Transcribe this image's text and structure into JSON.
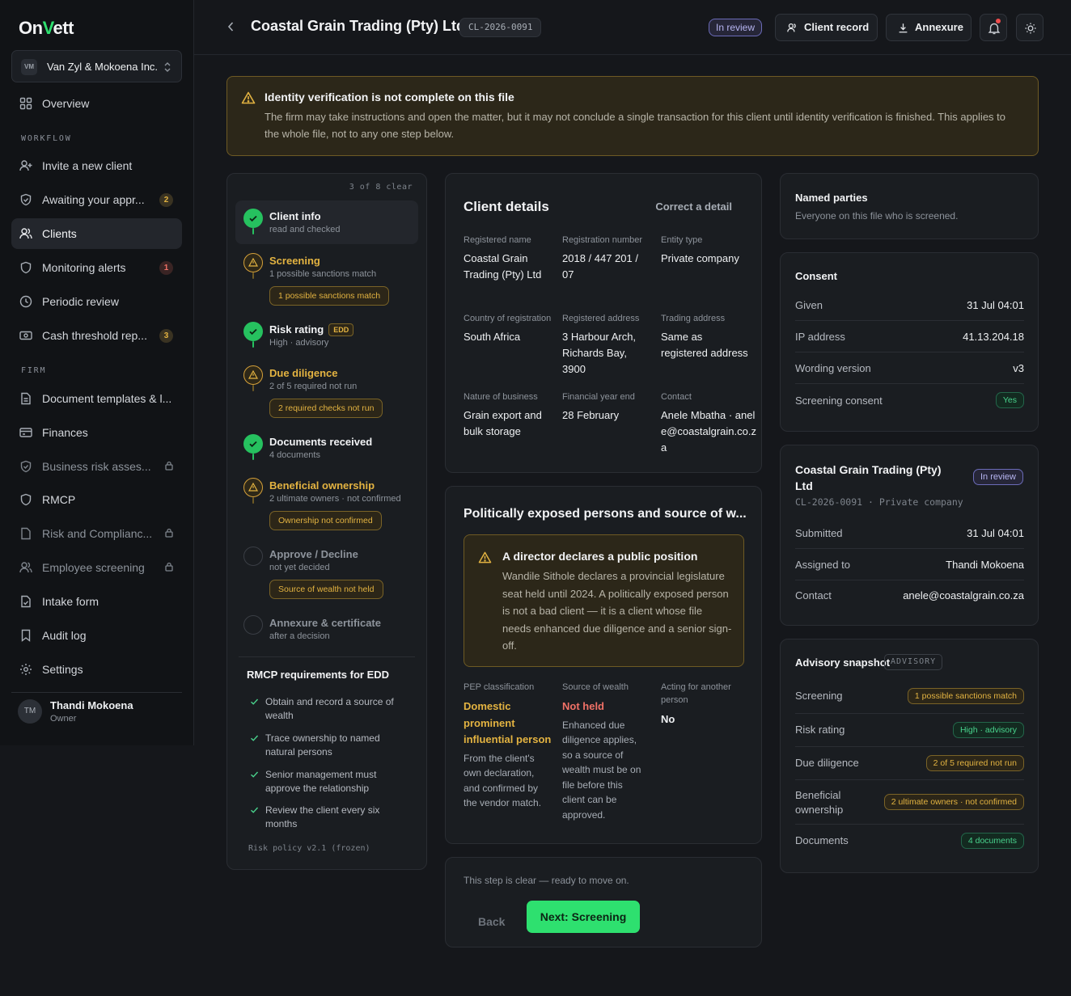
{
  "app": {
    "logo_prefix": "On",
    "logo_v": "V",
    "logo_suffix": "ett"
  },
  "org": {
    "initials": "VM",
    "name": "Van Zyl & Mokoena Inc."
  },
  "nav": {
    "overview": "Overview",
    "workflow_label": "WORKFLOW",
    "invite": "Invite a new client",
    "awaiting": "Awaiting your appr...",
    "awaiting_count": "2",
    "clients": "Clients",
    "monitoring": "Monitoring alerts",
    "monitoring_count": "1",
    "periodic": "Periodic review",
    "cash": "Cash threshold rep...",
    "cash_count": "3",
    "firm_label": "FIRM",
    "templates": "Document templates & l...",
    "finances": "Finances",
    "business_risk": "Business risk asses...",
    "rmcp": "RMCP",
    "risk_compliance": "Risk and Complianc...",
    "employee": "Employee screening",
    "intake": "Intake form",
    "audit": "Audit log",
    "settings": "Settings"
  },
  "user": {
    "initials": "TM",
    "name": "Thandi Mokoena",
    "role": "Owner"
  },
  "header": {
    "title": "Coastal Grain Trading (Pty) Ltd",
    "client_id": "CL-2026-0091",
    "status": "In review",
    "client_record_btn": "Client record",
    "annexure_btn": "Annexure"
  },
  "alert": {
    "title": "Identity verification is not complete on this file",
    "body": "The firm may take instructions and open the matter, but it may not conclude a single transaction for this client until identity verification is finished. This applies to the whole file, not to any one step below."
  },
  "steps": {
    "count": "3 of 8 clear",
    "items": [
      {
        "name": "Client info",
        "sub": "read and checked"
      },
      {
        "name": "Screening",
        "sub": "1 possible sanctions match",
        "tag": "1 possible sanctions match"
      },
      {
        "name": "Risk rating",
        "badge": "EDD",
        "sub": "High · advisory"
      },
      {
        "name": "Due diligence",
        "sub": "2 of 5 required not run",
        "tag": "2 required checks not run"
      },
      {
        "name": "Documents received",
        "sub": "4 documents"
      },
      {
        "name": "Beneficial ownership",
        "sub": "2 ultimate owners · not confirmed",
        "tag": "Ownership not confirmed"
      },
      {
        "name": "Approve / Decline",
        "sub": "not yet decided",
        "tag": "Source of wealth not held"
      },
      {
        "name": "Annexure & certificate",
        "sub": "after a decision"
      }
    ],
    "req_title": "RMCP requirements for EDD",
    "reqs": [
      "Obtain and record a source of wealth",
      "Trace ownership to named natural persons",
      "Senior management must approve the relationship",
      "Review the client every six months"
    ],
    "policy": "Risk policy v2.1 (frozen)"
  },
  "client_details": {
    "title": "Client details",
    "correct_link": "Correct a detail",
    "fields": [
      {
        "label": "Registered name",
        "value": "Coastal Grain Trading (Pty) Ltd"
      },
      {
        "label": "Registration number",
        "value": "2018 / 447 201 / 07"
      },
      {
        "label": "Entity type",
        "value": "Private company"
      },
      {
        "label": "Country of registration",
        "value": "South Africa"
      },
      {
        "label": "Registered address",
        "value": "3 Harbour Arch, Richards Bay, 3900"
      },
      {
        "label": "Trading address",
        "value": "Same as registered address"
      },
      {
        "label": "Nature of business",
        "value": "Grain export and bulk storage"
      },
      {
        "label": "Financial year end",
        "value": "28 February"
      },
      {
        "label": "Contact",
        "value": "Anele Mbatha · anele@coastalgrain.co.za"
      }
    ]
  },
  "pep": {
    "title": "Politically exposed persons and source of w...",
    "warn_title": "A director declares a public position",
    "warn_body": "Wandile Sithole declares a provincial legislature seat held until 2024. A politically exposed person is not a bad client — it is a client whose file needs enhanced due diligence and a senior sign-off.",
    "classification_label": "PEP classification",
    "classification_value": "Domestic prominent influential person",
    "classification_note": "From the client's own declaration, and confirmed by the vendor match.",
    "wealth_label": "Source of wealth",
    "wealth_value": "Not held",
    "wealth_note": "Enhanced due diligence applies, so a source of wealth must be on file before this client can be approved.",
    "acting_label": "Acting for another person",
    "acting_value": "No"
  },
  "footer_step": {
    "note": "This step is clear — ready to move on.",
    "back": "Back",
    "next": "Next: Screening"
  },
  "named_parties": {
    "title": "Named parties",
    "sub": "Everyone on this file who is screened."
  },
  "consent": {
    "title": "Consent",
    "rows": [
      {
        "k": "Given",
        "v": "31 Jul 04:01"
      },
      {
        "k": "IP address",
        "v": "41.13.204.18"
      },
      {
        "k": "Wording version",
        "v": "v3"
      },
      {
        "k": "Screening consent",
        "v": "Yes"
      }
    ]
  },
  "summary": {
    "title": "Coastal Grain Trading (Pty) Ltd",
    "status": "In review",
    "meta": "CL-2026-0091 · Private company",
    "rows": [
      {
        "k": "Submitted",
        "v": "31 Jul 04:01"
      },
      {
        "k": "Assigned to",
        "v": "Thandi Mokoena"
      },
      {
        "k": "Contact",
        "v": "anele@coastalgrain.co.za"
      }
    ]
  },
  "advisory": {
    "title": "Advisory snapshot",
    "tag": "ADVISORY",
    "rows": [
      {
        "k": "Screening",
        "v": "1 possible sanctions match"
      },
      {
        "k": "Risk rating",
        "v": "High · advisory"
      },
      {
        "k": "Due diligence",
        "v": "2 of 5 required not run"
      },
      {
        "k": "Beneficial ownership",
        "v": "2 ultimate owners · not confirmed"
      },
      {
        "k": "Documents",
        "v": "4 documents"
      }
    ]
  },
  "colors": {
    "accent": "#2ee06f",
    "warning": "#e3b341",
    "danger": "#f07167",
    "success": "#49d38d",
    "review": "#b6b4f0"
  }
}
